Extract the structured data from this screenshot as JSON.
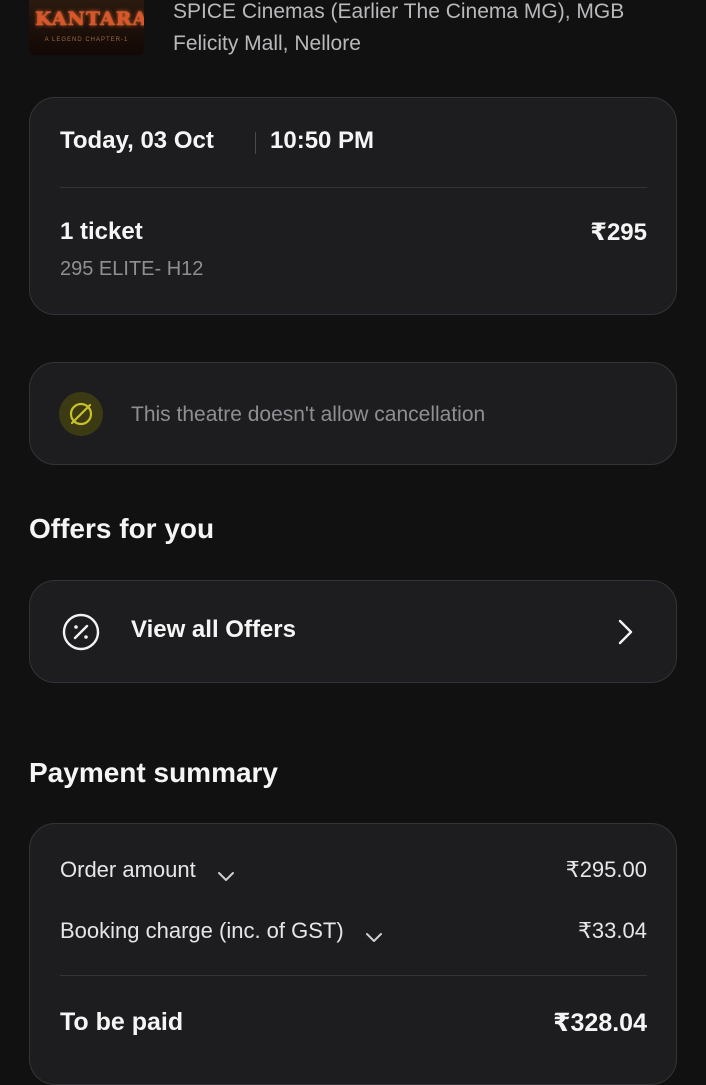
{
  "header": {
    "poster_title": "KANTARA",
    "poster_sub": "A LEGEND CHAPTER-1",
    "theatre_name": "SPICE Cinemas (Earlier The Cinema MG), MGB Felicity Mall, Nellore"
  },
  "show": {
    "date": "Today, 03 Oct",
    "time": "10:50 PM",
    "ticket_count": "1 ticket",
    "ticket_price": "₹295",
    "seat_info": "295 ELITE- H12"
  },
  "cancellation": {
    "icon": "no-cancel-icon",
    "text": "This theatre doesn't allow cancellation"
  },
  "offers": {
    "heading": "Offers for you",
    "icon": "discount-icon",
    "label": "View all Offers"
  },
  "payment": {
    "heading": "Payment summary",
    "order_amount_label": "Order amount",
    "order_amount_value": "₹295.00",
    "booking_charge_label": "Booking charge (inc. of GST)",
    "booking_charge_value": "₹33.04",
    "total_label": "To be paid",
    "total_value": "₹328.04"
  },
  "colors": {
    "background": "#111112",
    "card": "#1d1d20",
    "card_border": "#343438",
    "muted_text": "#8f8f93",
    "warning_icon": "#c9c12a"
  }
}
